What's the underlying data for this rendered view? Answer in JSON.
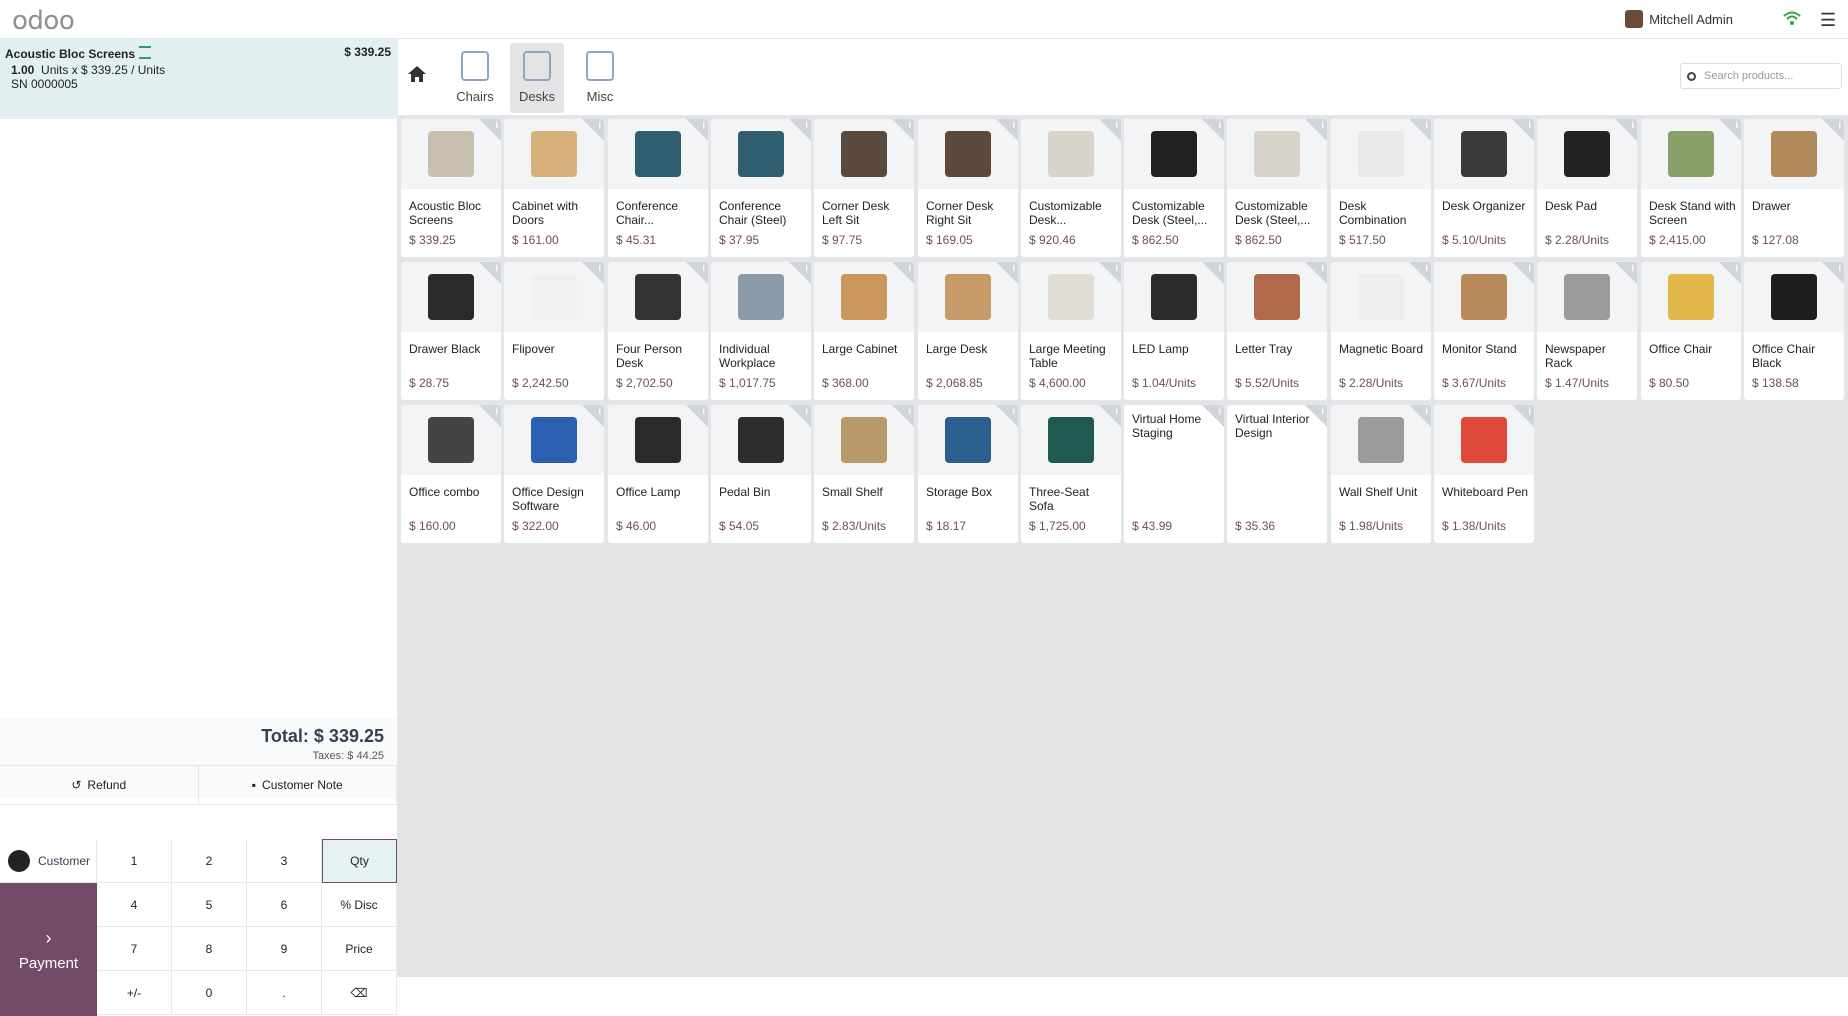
{
  "topbar": {
    "logo": "odoo",
    "user_name": "Mitchell Admin"
  },
  "order": {
    "line_name": "Acoustic Bloc Screens",
    "line_price": "$ 339.25",
    "line_qty": "1.00",
    "line_detail": "Units x $ 339.25 / Units",
    "line_sn": "SN 0000005",
    "total": "Total: $ 339.25",
    "taxes": "Taxes: $ 44.25"
  },
  "actions": {
    "refund": "Refund",
    "customer_note": "Customer Note"
  },
  "pad": {
    "customer": "Customer",
    "payment": "Payment",
    "keys": [
      "1",
      "2",
      "3",
      "Qty",
      "4",
      "5",
      "6",
      "% Disc",
      "7",
      "8",
      "9",
      "Price",
      "+/-",
      "0",
      ".",
      "⌫"
    ]
  },
  "categories": [
    {
      "label": "Chairs"
    },
    {
      "label": "Desks"
    },
    {
      "label": "Misc"
    }
  ],
  "search": {
    "placeholder": "Search products..."
  },
  "products": [
    {
      "name": "Acoustic Bloc Screens",
      "price": "$ 339.25",
      "color": "#c9bfae"
    },
    {
      "name": "Cabinet with Doors",
      "price": "$ 161.00",
      "color": "#d8b07a"
    },
    {
      "name": "Conference Chair...",
      "price": "$ 45.31",
      "color": "#2f5f6e"
    },
    {
      "name": "Conference Chair (Steel)",
      "price": "$ 37.95",
      "color": "#2f5f6e"
    },
    {
      "name": "Corner Desk Left Sit",
      "price": "$ 97.75",
      "color": "#5a4a3e"
    },
    {
      "name": "Corner Desk Right Sit",
      "price": "$ 169.05",
      "color": "#5a4a3e"
    },
    {
      "name": "Customizable Desk...",
      "price": "$ 920.46",
      "color": "#d8d4cc"
    },
    {
      "name": "Customizable Desk (Steel,...",
      "price": "$ 862.50",
      "color": "#222222"
    },
    {
      "name": "Customizable Desk (Steel,...",
      "price": "$ 862.50",
      "color": "#d8d4cc"
    },
    {
      "name": "Desk Combination",
      "price": "$ 517.50",
      "color": "#e9e9e9"
    },
    {
      "name": "Desk Organizer",
      "price": "$ 5.10/Units",
      "color": "#3a3a3a"
    },
    {
      "name": "Desk Pad",
      "price": "$ 2.28/Units",
      "color": "#222222"
    },
    {
      "name": "Desk Stand with Screen",
      "price": "$ 2,415.00",
      "color": "#8aa06a"
    },
    {
      "name": "Drawer",
      "price": "$ 127.08",
      "color": "#b08a5a"
    },
    {
      "name": "Drawer Black",
      "price": "$ 28.75",
      "color": "#2a2a2a"
    },
    {
      "name": "Flipover",
      "price": "$ 2,242.50",
      "color": "#f0f0f0"
    },
    {
      "name": "Four Person Desk",
      "price": "$ 2,702.50",
      "color": "#333333"
    },
    {
      "name": "Individual Workplace",
      "price": "$ 1,017.75",
      "color": "#8a9aa8"
    },
    {
      "name": "Large Cabinet",
      "price": "$ 368.00",
      "color": "#c9965e"
    },
    {
      "name": "Large Desk",
      "price": "$ 2,068.85",
      "color": "#c79a6a"
    },
    {
      "name": "Large Meeting Table",
      "price": "$ 4,600.00",
      "color": "#e0ddd5"
    },
    {
      "name": "LED Lamp",
      "price": "$ 1.04/Units",
      "color": "#2b2b2b"
    },
    {
      "name": "Letter Tray",
      "price": "$ 5.52/Units",
      "color": "#b06a4a"
    },
    {
      "name": "Magnetic Board",
      "price": "$ 2.28/Units",
      "color": "#eeeeee"
    },
    {
      "name": "Monitor Stand",
      "price": "$ 3.67/Units",
      "color": "#b8895a"
    },
    {
      "name": "Newspaper Rack",
      "price": "$ 1.47/Units",
      "color": "#9a9a9a"
    },
    {
      "name": "Office Chair",
      "price": "$ 80.50",
      "color": "#e2b84a"
    },
    {
      "name": "Office Chair Black",
      "price": "$ 138.58",
      "color": "#1e1e1e"
    },
    {
      "name": "Office combo",
      "price": "$ 160.00",
      "color": "#444444"
    },
    {
      "name": "Office Design Software",
      "price": "$ 322.00",
      "color": "#2b5fb0"
    },
    {
      "name": "Office Lamp",
      "price": "$ 46.00",
      "color": "#2a2a2a"
    },
    {
      "name": "Pedal Bin",
      "price": "$ 54.05",
      "color": "#2c2c2c"
    },
    {
      "name": "Small Shelf",
      "price": "$ 2.83/Units",
      "color": "#b89a6a"
    },
    {
      "name": "Storage Box",
      "price": "$ 18.17",
      "color": "#2b5f8e"
    },
    {
      "name": "Three-Seat Sofa",
      "price": "$ 1,725.00",
      "color": "#1f5a52"
    },
    {
      "name": "Virtual Home Staging",
      "price": "$ 43.99",
      "color": "",
      "noimg": true
    },
    {
      "name": "Virtual Interior Design",
      "price": "$ 35.36",
      "color": "",
      "noimg": true
    },
    {
      "name": "Wall Shelf Unit",
      "price": "$ 1.98/Units",
      "color": "#9a9a9a"
    },
    {
      "name": "Whiteboard Pen",
      "price": "$ 1.38/Units",
      "color": "#e04a3a"
    }
  ],
  "colors": {
    "brand": "#714B67",
    "selected_line": "#e2f0f2"
  }
}
